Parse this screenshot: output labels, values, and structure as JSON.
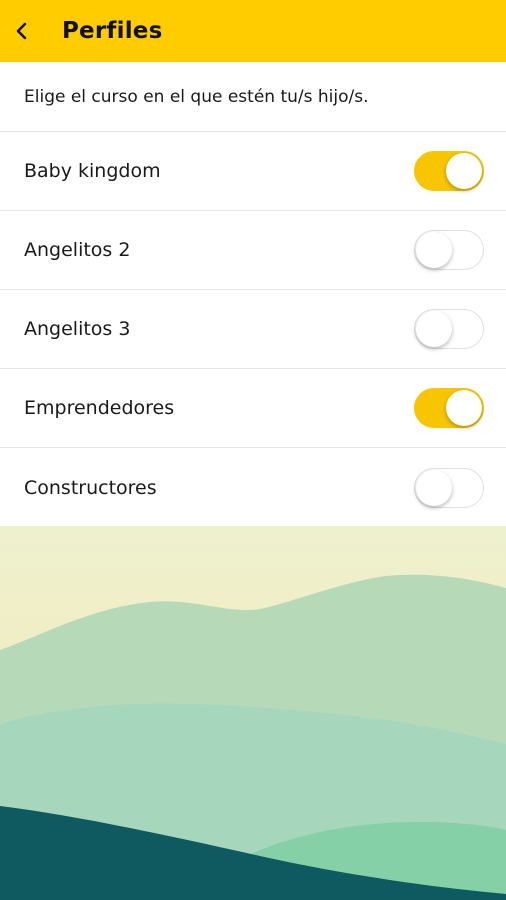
{
  "header": {
    "title": "Perfiles"
  },
  "intro": {
    "text": "Elige el curso en el que estén tu/s hijo/s."
  },
  "profiles": [
    {
      "label": "Baby kingdom",
      "enabled": true
    },
    {
      "label": "Angelitos 2",
      "enabled": false
    },
    {
      "label": "Angelitos 3",
      "enabled": false
    },
    {
      "label": "Emprendedores",
      "enabled": true
    },
    {
      "label": "Constructores",
      "enabled": false
    }
  ],
  "colors": {
    "app_bar": "#FFCC00",
    "toggle_on": "#F7C600",
    "toggle_off": "#FFFFFF",
    "sky_top": "#EEF1CF",
    "sky_bottom": "#F6E7AE",
    "hill_far": "#B6DAB8",
    "hill_mid": "#A6D6BB",
    "hill_near": "#85D0A6",
    "ground_dark": "#0F5A60"
  },
  "icons": {
    "back": "chevron-left-icon"
  }
}
